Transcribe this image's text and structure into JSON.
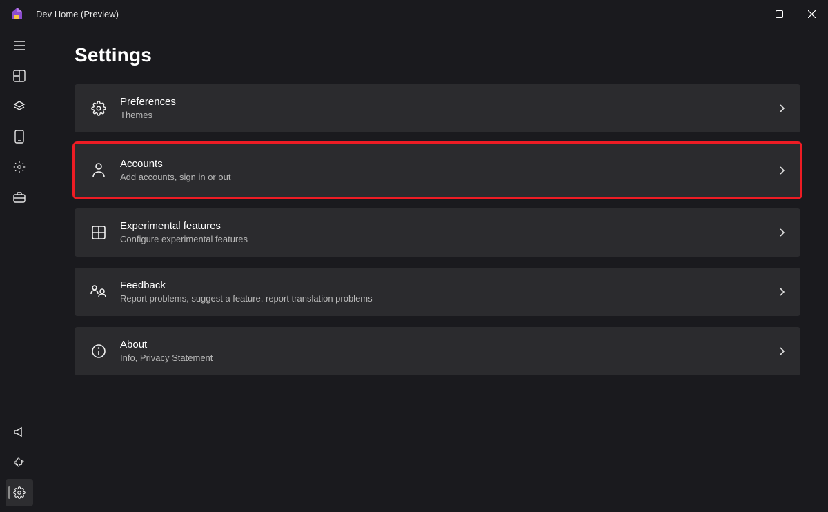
{
  "app": {
    "title": "Dev Home (Preview)"
  },
  "page": {
    "title": "Settings"
  },
  "cards": {
    "preferences": {
      "title": "Preferences",
      "subtitle": "Themes"
    },
    "accounts": {
      "title": "Accounts",
      "subtitle": "Add accounts, sign in or out"
    },
    "experimental": {
      "title": "Experimental features",
      "subtitle": "Configure experimental features"
    },
    "feedback": {
      "title": "Feedback",
      "subtitle": "Report problems, suggest a feature, report translation problems"
    },
    "about": {
      "title": "About",
      "subtitle": "Info, Privacy Statement"
    }
  }
}
